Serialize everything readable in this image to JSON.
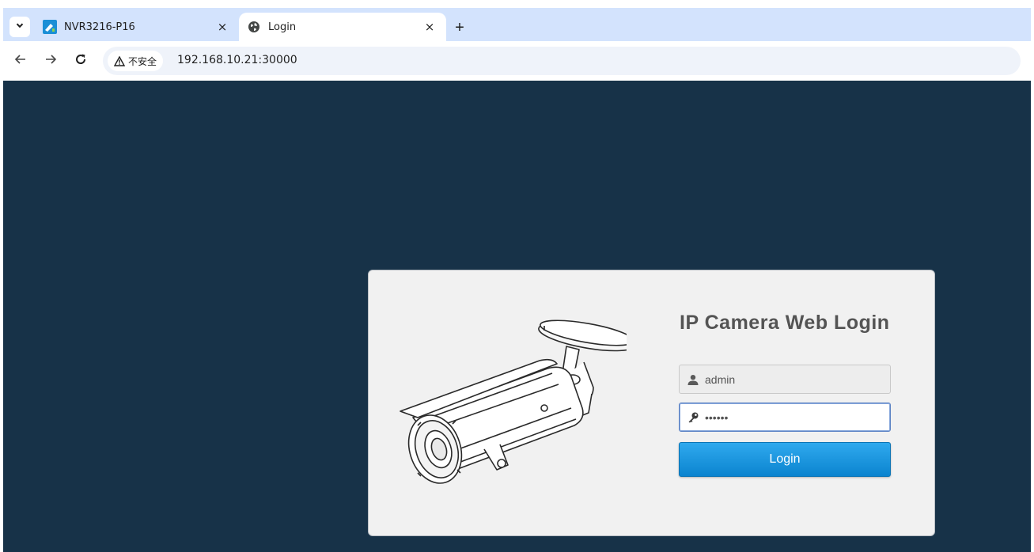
{
  "browser": {
    "tabs": [
      {
        "title": "NVR3216-P16",
        "icon": "nvr-favicon",
        "active": false
      },
      {
        "title": "Login",
        "icon": "globe-icon",
        "active": true
      }
    ],
    "close_glyph": "×",
    "new_tab_glyph": "+",
    "address": {
      "security_label": "不安全",
      "url": "192.168.10.21:30000"
    }
  },
  "login": {
    "title": "IP Camera Web Login",
    "username_value": "admin",
    "password_value": "123456",
    "button_label": "Login"
  },
  "colors": {
    "page_background": "#173248",
    "tabstrip": "#d3e3fd",
    "button": "#1a98e0"
  }
}
